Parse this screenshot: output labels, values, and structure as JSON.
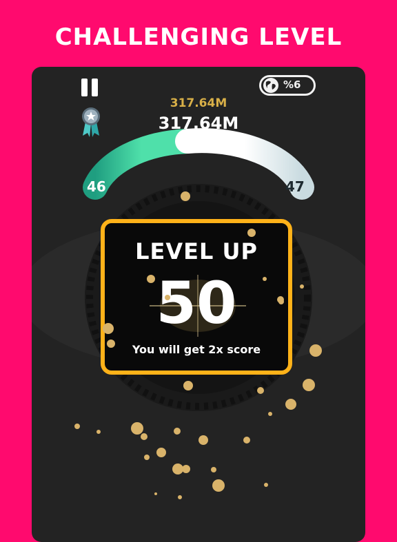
{
  "headline": "CHALLENGING LEVEL",
  "hud": {
    "best_score": "317.64M",
    "current_score": "317.64M",
    "world_rank": "%6",
    "level_from": "46",
    "level_to": "47",
    "level_progress": 0.5
  },
  "level_up": {
    "title": "LEVEL UP",
    "level": "50",
    "message": "You will get 2x score"
  },
  "colors": {
    "background": "#ff0a6e",
    "panel": "#232323",
    "accent_gold": "#ffb219",
    "progress_green": "#3ed4a0",
    "score_gold": "#d9b048"
  },
  "icons": [
    "pause-icon",
    "globe-icon",
    "medal-icon"
  ]
}
